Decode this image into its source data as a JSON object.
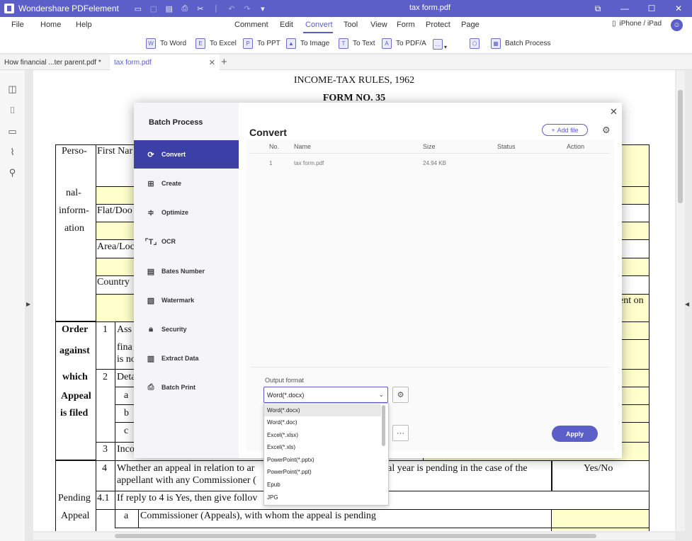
{
  "app": {
    "name": "Wondershare PDFelement",
    "doc_title": "tax form.pdf"
  },
  "menu": {
    "items": [
      "File",
      "Home",
      "Help",
      "Comment",
      "Edit",
      "Convert",
      "Tool",
      "View",
      "Form",
      "Protect",
      "Page"
    ],
    "active": "Convert",
    "device": "iPhone / iPad"
  },
  "toolbar": {
    "to_word": "To Word",
    "to_excel": "To Excel",
    "to_ppt": "To PPT",
    "to_image": "To Image",
    "to_text": "To Text",
    "to_pdfa": "To PDF/A",
    "batch_process": "Batch Process"
  },
  "tabs": [
    "How financial ...ter parent.pdf *",
    "tax form.pdf"
  ],
  "document": {
    "heading": "INCOME-TAX RULES, 1962",
    "subheading": "FORM NO. 35",
    "labels": {
      "perso": "Perso-",
      "nal": "nal-",
      "inform": "inform-",
      "ation": "ation",
      "first_name": "First Nar",
      "flat": "Flat/Doo",
      "area": "Area/Loc",
      "country": "Country",
      "ent_on": "ent on",
      "order": "Order",
      "against": "against",
      "which": "which",
      "appeal": "Appeal",
      "is_filed": "is filed",
      "n1": "1",
      "ass": "Ass",
      "fina": "fina",
      "isno": "is no",
      "n2": "2",
      "deta": "Deta",
      "a": "a",
      "b": "b",
      "c": "c",
      "n3": "3",
      "inco": "Inco",
      "n4": "4",
      "row4_text_a": "Whether an appeal in relation to ar",
      "row4_text_b": "cial year is pending in the case of the",
      "row4_text_c": "appellant with any Commissioner (",
      "yes_no": "Yes/No",
      "pending": "Pending",
      "appeal2": "Appeal",
      "n41": "4.1",
      "if_reply": "If reply to 4 is Yes, then give follov",
      "a2": "a",
      "commissioner": "Commissioner (Appeals), with whom the appeal is pending"
    }
  },
  "dialog": {
    "title": "Batch Process",
    "sidebar": [
      "Convert",
      "Create",
      "Optimize",
      "OCR",
      "Bates Number",
      "Watermark",
      "Security",
      "Extract Data",
      "Batch Print"
    ],
    "active": "Convert",
    "heading": "Convert",
    "add_file": "Add file",
    "columns": [
      "No.",
      "Name",
      "Size",
      "Status",
      "Action"
    ],
    "rows": [
      {
        "no": "1",
        "name": "tax form.pdf",
        "size": "24.94 KB",
        "status": "",
        "action": ""
      }
    ],
    "output_format_label": "Output format",
    "output_format_value": "Word(*.docx)",
    "apply": "Apply",
    "more": "···",
    "format_options": [
      "Word(*.docx)",
      "Word(*.doc)",
      "Excel(*.xlsx)",
      "Excel(*.xls)",
      "PowerPoint(*.pptx)",
      "PowerPoint(*.ppt)",
      "Epub",
      "JPG"
    ]
  },
  "colors": {
    "accent": "#5b5fc7",
    "active_sidebar": "#3b3fa6",
    "form_yellow": "#ffffcc"
  }
}
